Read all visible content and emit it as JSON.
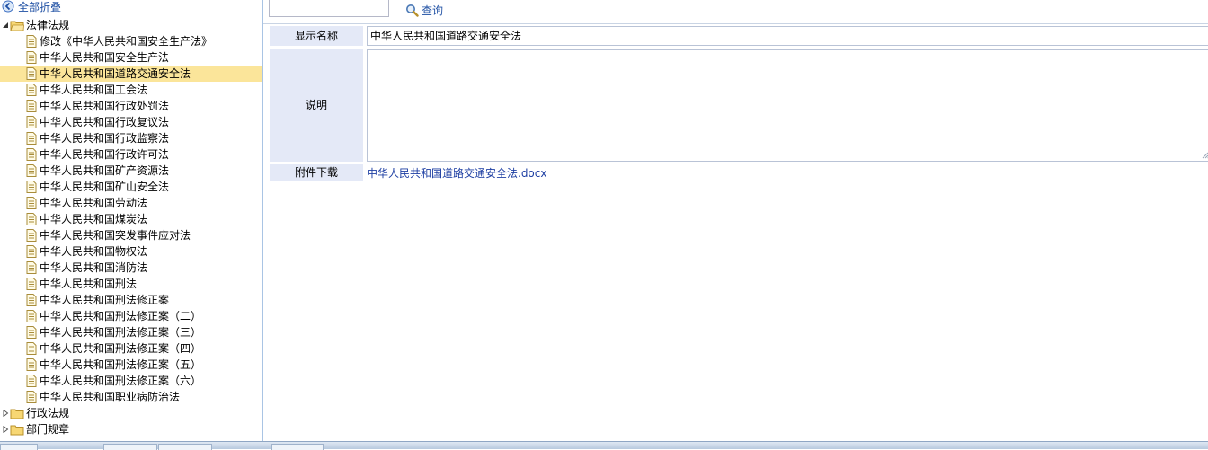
{
  "tree": {
    "collapse_all_label": "全部折叠",
    "root_label": "法律法规",
    "items": [
      "修改《中华人民共和国安全生产法》",
      "中华人民共和国安全生产法",
      "中华人民共和国道路交通安全法",
      "中华人民共和国工会法",
      "中华人民共和国行政处罚法",
      "中华人民共和国行政复议法",
      "中华人民共和国行政监察法",
      "中华人民共和国行政许可法",
      "中华人民共和国矿产资源法",
      "中华人民共和国矿山安全法",
      "中华人民共和国劳动法",
      "中华人民共和国煤炭法",
      "中华人民共和国突发事件应对法",
      "中华人民共和国物权法",
      "中华人民共和国消防法",
      "中华人民共和国刑法",
      "中华人民共和国刑法修正案",
      "中华人民共和国刑法修正案（二）",
      "中华人民共和国刑法修正案（三）",
      "中华人民共和国刑法修正案（四）",
      "中华人民共和国刑法修正案（五）",
      "中华人民共和国刑法修正案（六）",
      "中华人民共和国职业病防治法"
    ],
    "selected_label": "中华人民共和国道路交通安全法",
    "other_folders": [
      "行政法规",
      "部门规章"
    ]
  },
  "search": {
    "value": "",
    "button_label": "查询"
  },
  "detail": {
    "name_label": "显示名称",
    "name_value": "中华人民共和国道路交通安全法",
    "desc_label": "说明",
    "desc_value": "",
    "attach_label": "附件下载",
    "attach_link": "中华人民共和国道路交通安全法.docx"
  },
  "colors": {
    "selected_row": "#fbe59a",
    "label_bg": "#e4e9f7",
    "link": "#1e3fa3",
    "folder": "#f2c94c"
  }
}
